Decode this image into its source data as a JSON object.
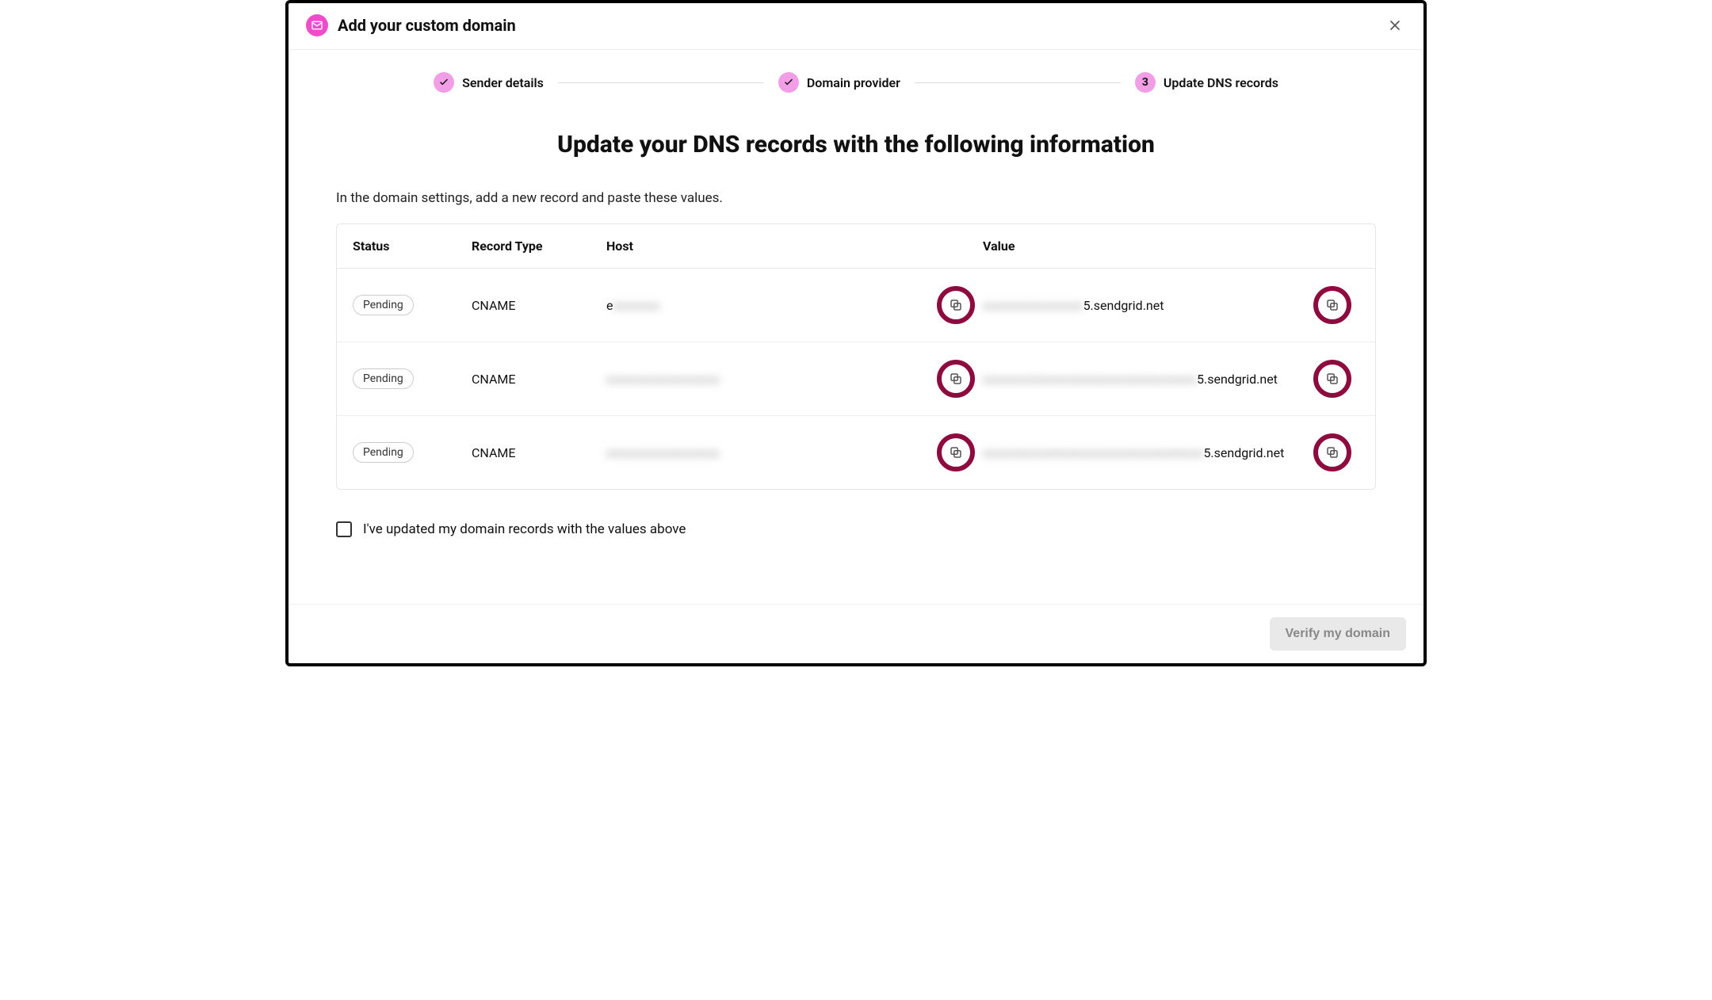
{
  "header": {
    "title": "Add your custom domain"
  },
  "stepper": {
    "steps": [
      {
        "label": "Sender details",
        "state": "done"
      },
      {
        "label": "Domain provider",
        "state": "done"
      },
      {
        "label": "Update DNS records",
        "state": "current",
        "number": "3"
      }
    ]
  },
  "main": {
    "heading": "Update your DNS records with the following information",
    "subtext": "In the domain settings, add a new record and paste these values.",
    "columns": {
      "status": "Status",
      "record_type": "Record Type",
      "host": "Host",
      "value": "Value"
    },
    "rows": [
      {
        "status": "Pending",
        "record_type": "CNAME",
        "host_prefix": "e",
        "host_hidden": "xxxxxxx",
        "value_hidden": "xxxxxxxxxxxxxxx",
        "value_suffix": "5.sendgrid.net"
      },
      {
        "status": "Pending",
        "record_type": "CNAME",
        "host_prefix": "",
        "host_hidden": "xxxxxxxxxxxxxxxxx",
        "value_hidden": "xxxxxxxxxxxxxxxxxxxxxxxxxxxxxxxx",
        "value_suffix": "5.sendgrid.net"
      },
      {
        "status": "Pending",
        "record_type": "CNAME",
        "host_prefix": "",
        "host_hidden": "xxxxxxxxxxxxxxxxx",
        "value_hidden": "xxxxxxxxxxxxxxxxxxxxxxxxxxxxxxxxx",
        "value_suffix": "5.sendgrid.net"
      }
    ],
    "confirm_label": "I've updated my domain records with the values above"
  },
  "footer": {
    "verify_label": "Verify my domain"
  }
}
